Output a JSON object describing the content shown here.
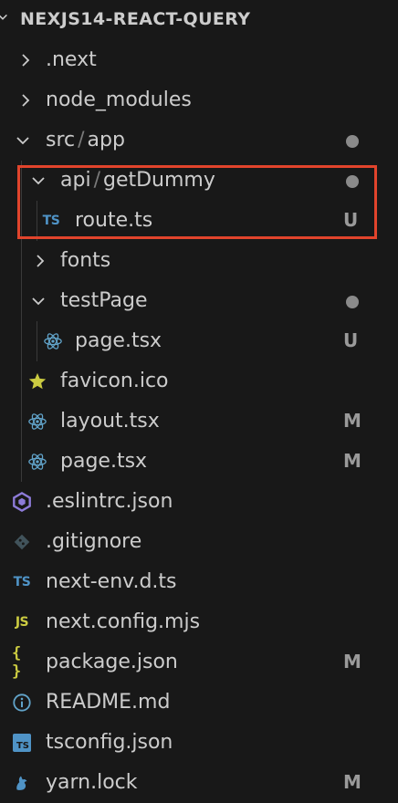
{
  "explorer": {
    "section_title": "NEXJS14-REACT-QUERY",
    "items": [
      {
        "label": ".next",
        "icon": "chevron-right-icon",
        "status": ""
      },
      {
        "label": "node_modules",
        "icon": "chevron-right-icon",
        "status": ""
      },
      {
        "label_parts": [
          "src",
          "/",
          "app"
        ],
        "icon": "chevron-down-icon",
        "status": "modified-dot"
      },
      {
        "label_parts": [
          "api",
          "/",
          "getDummy"
        ],
        "icon": "chevron-down-icon",
        "status": "modified-dot"
      },
      {
        "label": "route.ts",
        "icon": "typescript-icon",
        "badge": "TS",
        "status": "U"
      },
      {
        "label": "fonts",
        "icon": "chevron-right-icon",
        "status": ""
      },
      {
        "label": "testPage",
        "icon": "chevron-down-icon",
        "status": "modified-dot"
      },
      {
        "label": "page.tsx",
        "icon": "react-icon",
        "status": "U"
      },
      {
        "label": "favicon.ico",
        "icon": "star-icon",
        "status": ""
      },
      {
        "label": "layout.tsx",
        "icon": "react-icon",
        "status": "M"
      },
      {
        "label": "page.tsx",
        "icon": "react-icon",
        "status": "M"
      },
      {
        "label": ".eslintrc.json",
        "icon": "eslint-icon",
        "status": ""
      },
      {
        "label": ".gitignore",
        "icon": "git-icon",
        "status": ""
      },
      {
        "label": "next-env.d.ts",
        "icon": "typescript-icon",
        "badge": "TS",
        "status": ""
      },
      {
        "label": "next.config.mjs",
        "icon": "javascript-icon",
        "badge": "JS",
        "status": ""
      },
      {
        "label": "package.json",
        "icon": "json-icon",
        "badge": "{ }",
        "status": "M"
      },
      {
        "label": "README.md",
        "icon": "info-icon",
        "status": ""
      },
      {
        "label": "tsconfig.json",
        "icon": "tsconfig-icon",
        "badge": "TS",
        "status": ""
      },
      {
        "label": "yarn.lock",
        "icon": "yarn-icon",
        "status": "M"
      }
    ]
  },
  "colors": {
    "background": "#181818",
    "text": "#cccccc",
    "highlight_border": "#e1442c",
    "react": "#61a3c9",
    "typescript": "#4f93c6",
    "javascript": "#cbcb41",
    "eslint": "#8d7bd8",
    "yarn": "#4f93c6"
  }
}
